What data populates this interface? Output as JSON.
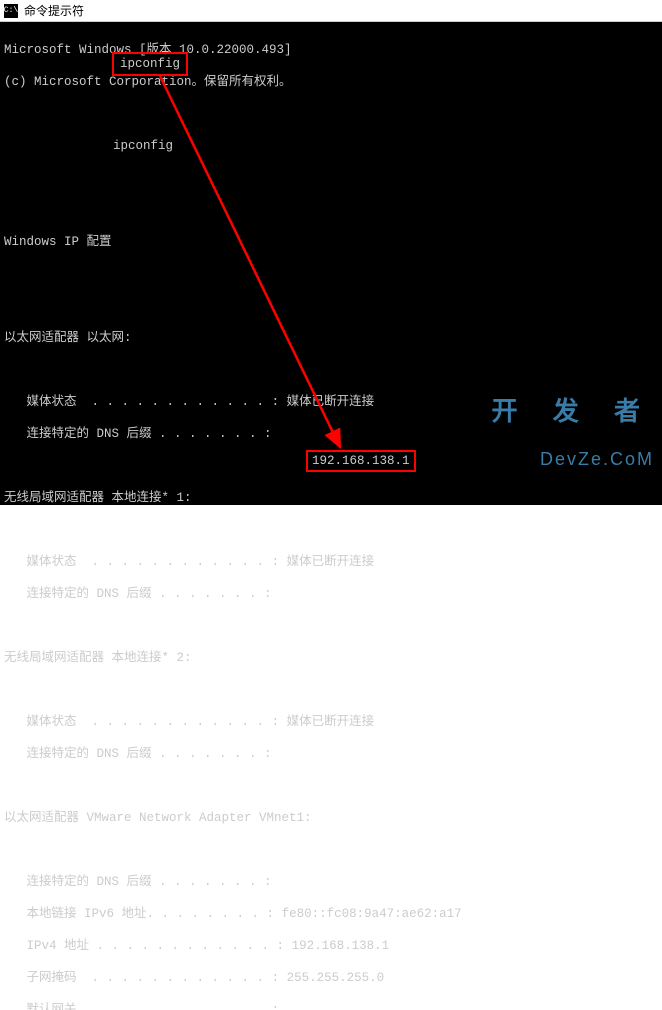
{
  "window": {
    "title": "命令提示符",
    "icon_label": "C:\\"
  },
  "header": {
    "line1": "Microsoft Windows [版本 10.0.22000.493]",
    "line2": "(c) Microsoft Corporation。保留所有权利。"
  },
  "prompt": {
    "path_redacted": "C:\\",
    "command": "ipconfig"
  },
  "output": {
    "title": "Windows IP 配置",
    "adapters": [
      {
        "header": "以太网适配器 以太网:",
        "lines": [
          {
            "label": "媒体状态",
            "dots": "  . . . . . . . . . . . . :",
            "value": " 媒体已断开连接"
          },
          {
            "label": "连接特定的 DNS 后缀",
            "dots": " . . . . . . . :",
            "value": ""
          }
        ]
      },
      {
        "header": "无线局域网适配器 本地连接* 1:",
        "lines": [
          {
            "label": "媒体状态",
            "dots": "  . . . . . . . . . . . . :",
            "value": " 媒体已断开连接"
          },
          {
            "label": "连接特定的 DNS 后缀",
            "dots": " . . . . . . . :",
            "value": ""
          }
        ]
      },
      {
        "header": "无线局域网适配器 本地连接* 2:",
        "lines": [
          {
            "label": "媒体状态",
            "dots": "  . . . . . . . . . . . . :",
            "value": " 媒体已断开连接"
          },
          {
            "label": "连接特定的 DNS 后缀",
            "dots": " . . . . . . . :",
            "value": ""
          }
        ]
      },
      {
        "header": "以太网适配器 VMware Network Adapter VMnet1:",
        "lines": [
          {
            "label": "连接特定的 DNS 后缀",
            "dots": " . . . . . . . :",
            "value": ""
          },
          {
            "label": "本地链接 IPv6 地址",
            "dots": ". . . . . . . . :",
            "value": " fe80::fc08:9a47:ae62:a17"
          },
          {
            "label": "IPv4 地址",
            "dots": " . . . . . . . . . . . . :",
            "value": " 192.168.138.1"
          },
          {
            "label": "子网掩码",
            "dots": "  . . . . . . . . . . . . :",
            "value": " 255.255.255.0"
          },
          {
            "label": "默认网关",
            "dots": ". . . . . . . . . . . . . :",
            "value": ""
          }
        ]
      }
    ]
  },
  "annotations": {
    "command_highlight": "ipconfig",
    "ipv4_highlight": "192.168.138.1"
  },
  "watermark": {
    "line1": "开 发 者",
    "line2": "DevZe.CoM"
  }
}
